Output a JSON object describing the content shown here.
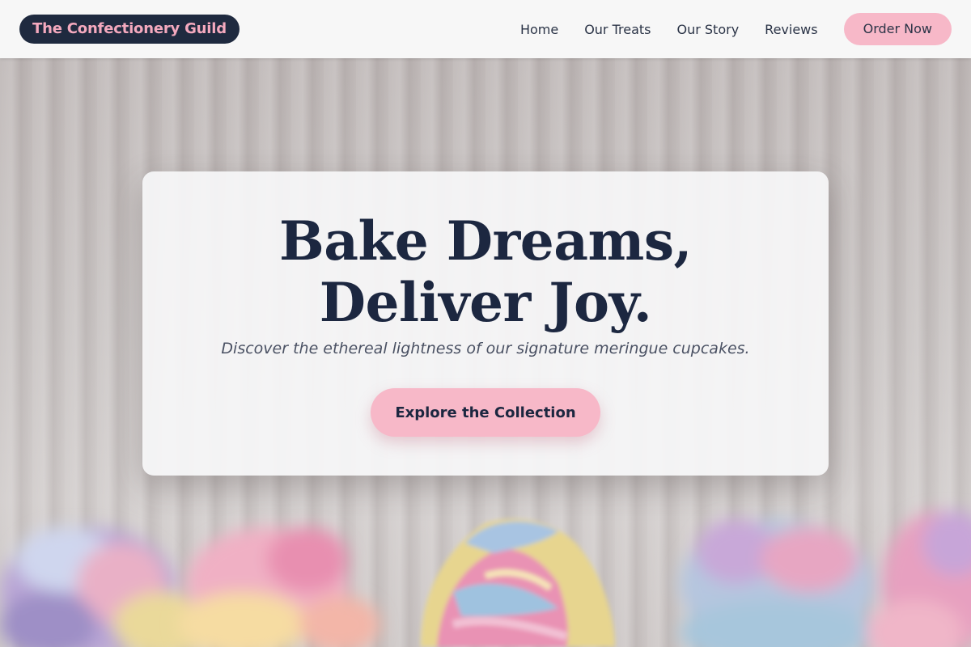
{
  "brand": {
    "name": "The Confectionery Guild"
  },
  "nav": {
    "items": [
      {
        "label": "Home"
      },
      {
        "label": "Our Treats"
      },
      {
        "label": "Our Story"
      },
      {
        "label": "Reviews"
      }
    ],
    "cta_label": "Order Now"
  },
  "hero": {
    "headline": "Bake Dreams, Deliver Joy.",
    "subheadline": "Discover the ethereal lightness of our signature meringue cupcakes.",
    "cta_label": "Explore the Collection",
    "background_image": "blurred pastel swirl meringue cupcakes"
  },
  "colors": {
    "navy": "#1f2a3f",
    "pink": "#f7b8c8",
    "header_bg": "#f7f7f7",
    "card_bg": "#f6f6f7"
  }
}
